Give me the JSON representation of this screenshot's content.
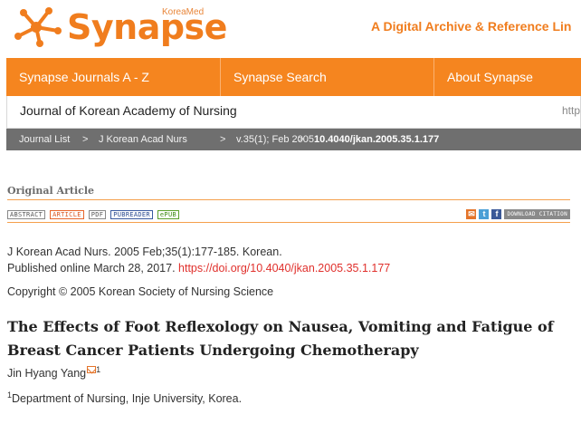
{
  "header": {
    "logo_text": "Synapse",
    "logo_sup": "KoreaMed",
    "tagline": "A Digital Archive & Reference Lin"
  },
  "nav": {
    "items": [
      {
        "label": "Synapse Journals  A - Z"
      },
      {
        "label": "Synapse Search"
      },
      {
        "label": "About Synapse"
      }
    ]
  },
  "journal": {
    "title": "Journal of Korean Academy of Nursing",
    "url_fragment": "http"
  },
  "breadcrumb": {
    "items": [
      "Journal List",
      ">",
      "J Korean Acad Nurs",
      ">",
      "v.35(1); Feb 2005",
      ">",
      "10.4040/jkan.2005.35.1.177"
    ]
  },
  "article": {
    "type": "Original Article",
    "formats": [
      "ABSTRACT",
      "ARTICLE",
      "PDF",
      "PUBREADER",
      "ePUB"
    ],
    "share_icons": [
      "mail-icon",
      "twitter-icon",
      "facebook-icon"
    ],
    "citation_button": "DOWNLOAD CITATION",
    "citation": "J Korean Acad Nurs. 2005 Feb;35(1):177-185. Korean.",
    "published_prefix": "Published online March 28, 2017.",
    "doi_link": "https://doi.org/10.4040/jkan.2005.35.1.177",
    "copyright": "Copyright © 2005 Korean Society of Nursing Science",
    "title": "The Effects of Foot Reflexology on Nausea, Vomiting and Fatigue of Breast Cancer Patients Undergoing Chemotherapy",
    "author": "Jin Hyang Yang",
    "author_sup": "1",
    "affiliation_sup": "1",
    "affiliation": "Department of Nursing, Inje University, Korea."
  },
  "colors": {
    "brand_orange": "#f5851f",
    "breadcrumb_gray": "#6f6f6f",
    "link_red": "#e0302c"
  }
}
